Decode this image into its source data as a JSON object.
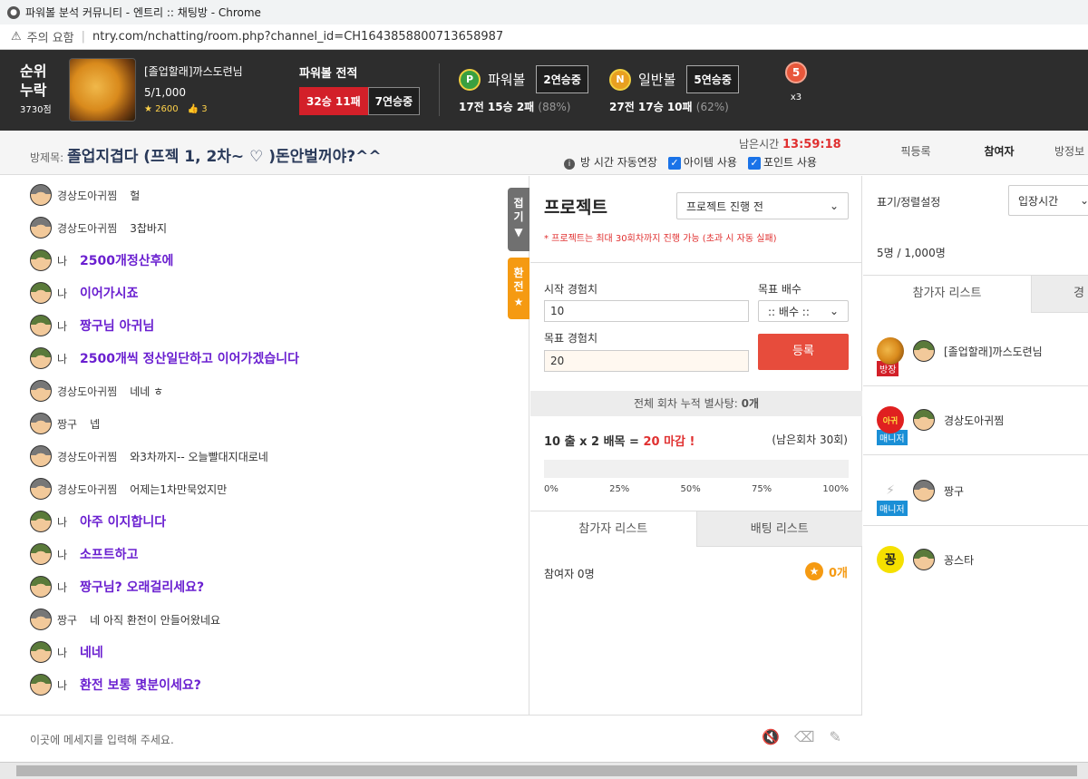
{
  "browser": {
    "title": "파워볼 분석 커뮤니티 - 엔트리 :: 채팅방 - Chrome",
    "warning": "주의 요함",
    "url": "ntry.com/nchatting/room.php?channel_id=CH1643858800713658987"
  },
  "header": {
    "rank_line1": "순위",
    "rank_line2": "누락",
    "rank_points": "3730점",
    "owner_name": "[졸업할래]까스도련님",
    "member_count": "5/1,000",
    "stars": "2600",
    "likes": "3",
    "record_label": "파워볼 전적",
    "record_wl": "32승 11패",
    "record_streak": "7연승중",
    "powerball": {
      "icon": "P",
      "name": "파워볼",
      "streak": "2연승중",
      "result": "17전 15승 2패",
      "pct": "(88%)"
    },
    "normalball": {
      "icon": "N",
      "name": "일반볼",
      "streak": "5연승중",
      "result": "27전 17승 10패",
      "pct": "(62%)"
    },
    "medal_num": "5",
    "medal_mult": "x3"
  },
  "room": {
    "title_label": "방제목:",
    "title": "졸업지겹다 (프젝 1, 2차~ ♡ )돈안벌꺼야?^^",
    "remain_label": "남은시간",
    "remain_time": "13:59:18",
    "opt_auto": "방 시간 자동연장",
    "opt_item": "아이템 사용",
    "opt_point": "포인트 사용",
    "tab_pick": "픽등록",
    "tab_members": "참여자",
    "tab_info": "방정보"
  },
  "chat": {
    "messages": [
      {
        "who": "경상도아귀찜",
        "text": "헐",
        "me": false
      },
      {
        "who": "경상도아귀찜",
        "text": "3찹바지",
        "me": false
      },
      {
        "who": "나",
        "text": "2500개정산후에",
        "me": true
      },
      {
        "who": "나",
        "text": "이어가시죠",
        "me": true
      },
      {
        "who": "나",
        "text": "짱구님 아귀님",
        "me": true
      },
      {
        "who": "나",
        "text": "2500개씩 정산일단하고 이어가겠습니다",
        "me": true
      },
      {
        "who": "경상도아귀찜",
        "text": "네네 ㅎ",
        "me": false
      },
      {
        "who": "짱구",
        "text": "넵",
        "me": false
      },
      {
        "who": "경상도아귀찜",
        "text": "와3차까지-- 오늘빨대지대로네",
        "me": false
      },
      {
        "who": "경상도아귀찜",
        "text": "어제는1차만묵었지만",
        "me": false
      },
      {
        "who": "나",
        "text": "아주 이지합니다",
        "me": true
      },
      {
        "who": "나",
        "text": "소프트하고",
        "me": true
      },
      {
        "who": "나",
        "text": "짱구님? 오래걸리세요?",
        "me": true
      },
      {
        "who": "짱구",
        "text": "네 아직 환전이 안들어왔네요",
        "me": false
      },
      {
        "who": "나",
        "text": "네네",
        "me": true
      },
      {
        "who": "나",
        "text": "환전 보통 몇분이세요?",
        "me": true
      }
    ],
    "side_fold": "접기",
    "side_exchange": "환전",
    "input_placeholder": "이곳에 메세지를 입력해 주세요."
  },
  "project": {
    "title": "프로젝트",
    "status_select": "프로젝트 진행 전",
    "note": "* 프로젝트는 최대 30회차까지 진행 가능 (초과 시 자동 실패)",
    "start_label": "시작 경험치",
    "start_value": "10",
    "mult_label": "목표 배수",
    "mult_select": ":: 배수 ::",
    "target_label": "목표 경험치",
    "target_value": "20",
    "register": "등록",
    "total_label": "전체 회차 누적 별사탕:",
    "total_value": "0개",
    "calc_a": "10 출 x 2 배목 =",
    "calc_b": "20 마감 !",
    "remain_rounds": "(남은회차 30회)",
    "progress": 0,
    "ticks": [
      "0%",
      "25%",
      "50%",
      "75%",
      "100%"
    ],
    "tab_participants": "참가자 리스트",
    "tab_betting": "배팅 리스트",
    "participants": "참여자 0명",
    "points": "0개"
  },
  "right": {
    "sort_label": "표기/정렬설정",
    "sort_select": "입장시간",
    "count": "5명 / 1,000명",
    "tab_participants": "참가자 리스트",
    "tab_other": "경",
    "members": [
      {
        "name": "[졸업할래]까스도련님",
        "role": "방장",
        "role_color": "#d32029",
        "pic": ""
      },
      {
        "name": "경상도아귀찜",
        "role": "매니저",
        "role_color": "#1a8fd6",
        "pic": "아귀"
      },
      {
        "name": "짱구",
        "role": "매니저",
        "role_color": "#1a8fd6",
        "pic": ""
      },
      {
        "name": "꽁스타",
        "role": "",
        "role_color": "",
        "pic": "꽁"
      }
    ]
  },
  "colors": {
    "accent_red": "#e74c3c",
    "chat_me": "#6a1fd0",
    "orange": "#f59a12"
  }
}
